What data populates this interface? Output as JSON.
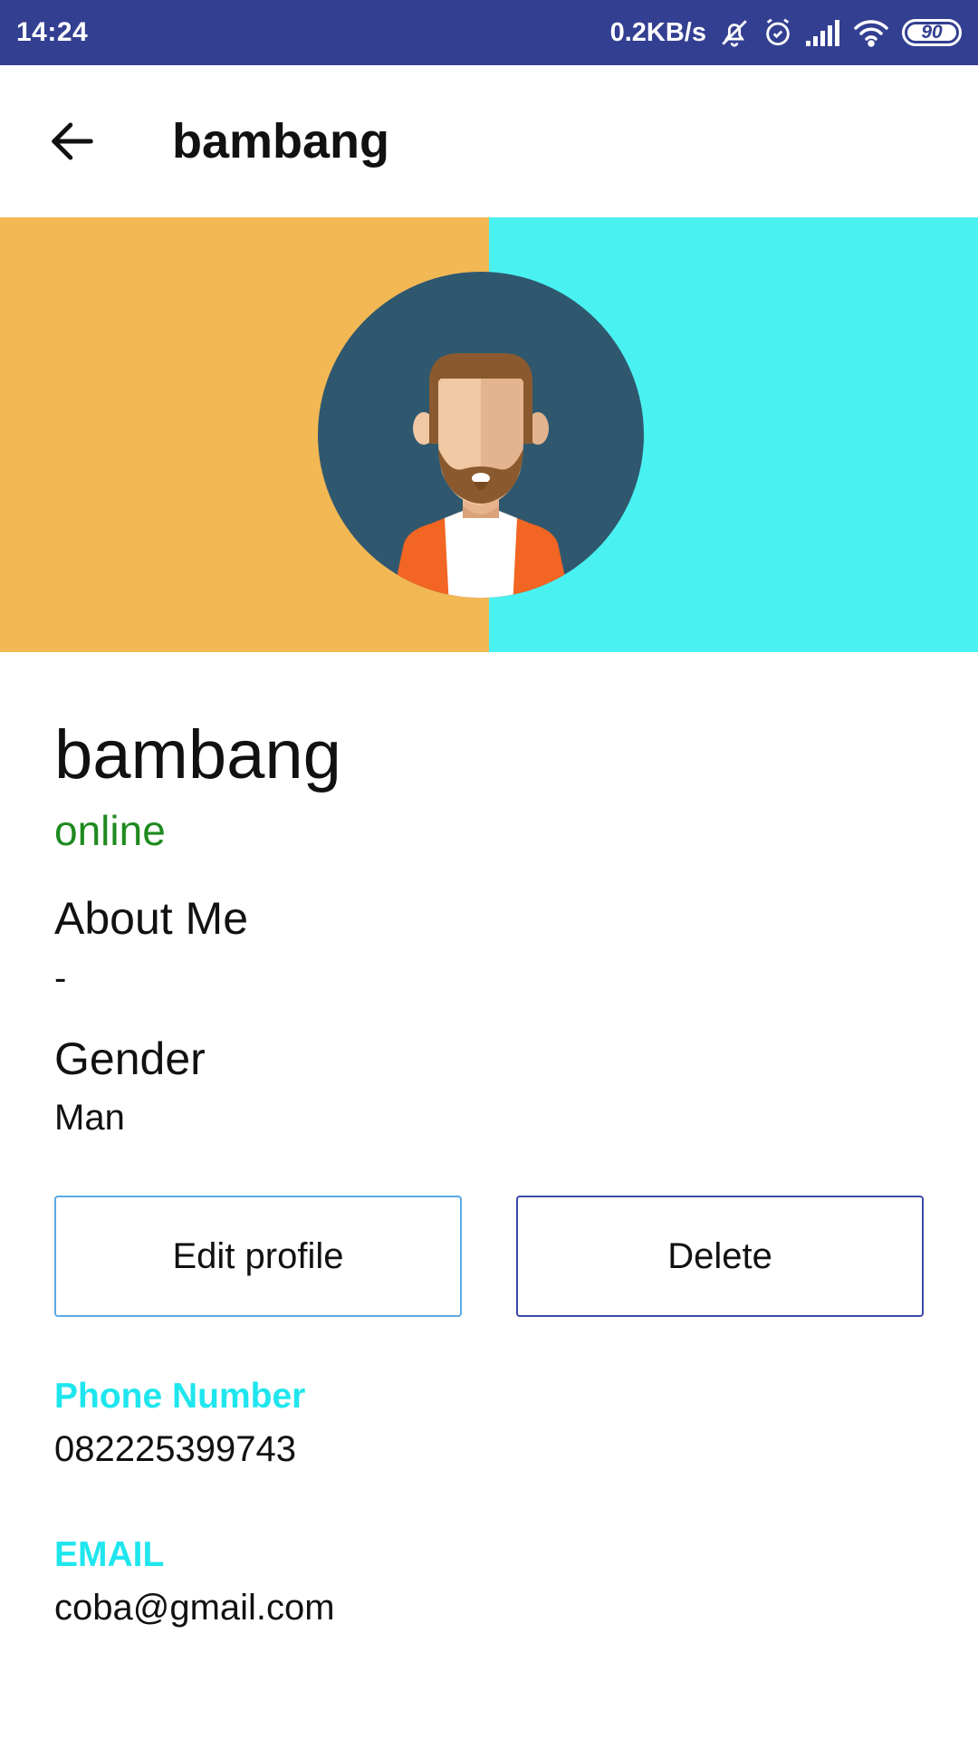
{
  "status_bar": {
    "time": "14:24",
    "network_speed": "0.2KB/s",
    "battery_level": "90",
    "icons": [
      "mute-icon",
      "alarm-icon",
      "signal-icon",
      "wifi-icon",
      "battery-icon"
    ]
  },
  "app_bar": {
    "back_icon": "arrow-left-icon",
    "title": "bambang"
  },
  "banner": {
    "left_color": "#f2b854",
    "right_color": "#4af1f1",
    "avatar": "male-avatar-with-beard"
  },
  "profile": {
    "name": "bambang",
    "status": "online",
    "status_color": "#1f8a1f",
    "about_label": "About Me",
    "about_value": "-",
    "gender_label": "Gender",
    "gender_value": "Man"
  },
  "actions": {
    "edit_label": "Edit profile",
    "delete_label": "Delete"
  },
  "contact": {
    "label_color": "#1fe6ee",
    "phone_label": "Phone Number",
    "phone_value": "082225399743",
    "email_label": "EMAIL",
    "email_value": "coba@gmail.com"
  }
}
